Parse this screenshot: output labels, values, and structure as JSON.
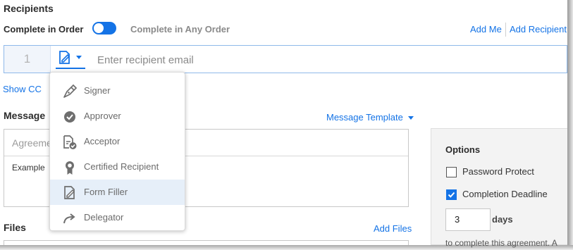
{
  "recipients": {
    "heading": "Recipients",
    "complete_in_order_label": "Complete in Order",
    "complete_any_order_label": "Complete in Any Order",
    "order_toggle_state": "on",
    "add_me_link": "Add Me",
    "add_recipient_link": "Add Recipient",
    "row": {
      "order_number": "1",
      "email_placeholder": "Enter recipient email",
      "email_value": ""
    },
    "show_cc_link": "Show CC"
  },
  "role_menu": {
    "items": [
      {
        "label": "Signer",
        "icon": "pen-nib-icon"
      },
      {
        "label": "Approver",
        "icon": "check-circle-icon"
      },
      {
        "label": "Acceptor",
        "icon": "document-check-icon"
      },
      {
        "label": "Certified Recipient",
        "icon": "certified-ribbon-icon"
      },
      {
        "label": "Form Filler",
        "icon": "form-edit-icon",
        "selected": true
      },
      {
        "label": "Delegator",
        "icon": "forward-arrow-icon"
      }
    ]
  },
  "message": {
    "heading": "Message",
    "template_link": "Message Template",
    "agreement_name_placeholder": "Agreement",
    "body_text": "Example"
  },
  "files": {
    "heading": "Files",
    "add_files_link": "Add Files"
  },
  "options": {
    "heading": "Options",
    "password_protect_label": "Password Protect",
    "password_protect_checked": false,
    "completion_deadline_label": "Completion Deadline",
    "completion_deadline_checked": true,
    "days_value": "3",
    "days_label": "days",
    "deadline_note": "to complete this agreement. A"
  },
  "colors": {
    "accent": "#1473e6",
    "selected_row": "#e6eff9",
    "panel_bg": "#f3f3f3"
  }
}
